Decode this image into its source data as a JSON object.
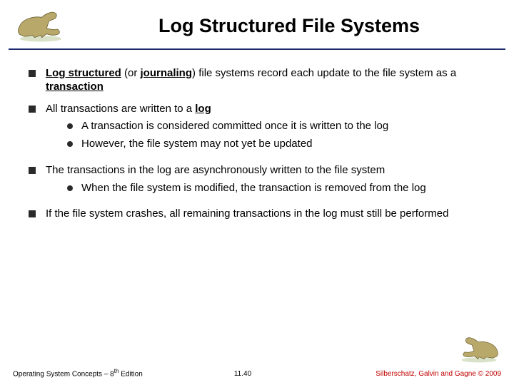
{
  "title": "Log Structured File Systems",
  "bullets": {
    "b1_pre": "Log structured",
    "b1_mid_paren_open": " (or ",
    "b1_journaling": "journaling",
    "b1_mid_paren_close": ") ",
    "b1_post": "file systems record each update to the file system as a ",
    "b1_transaction": "transaction",
    "b2": "All transactions are written to a ",
    "b2_log": "log",
    "b2s1": "A transaction is considered committed once it is written to the log",
    "b2s2": "However, the file system may not yet be updated",
    "b3": "The transactions in the log are asynchronously written to the file system",
    "b3s1": "When the file system is modified, the transaction is removed from the log",
    "b4": "If the file system crashes, all remaining transactions in the log must still be performed"
  },
  "footer": {
    "left_pre": "Operating System Concepts – 8",
    "left_sup": "th",
    "left_post": " Edition",
    "mid": "11.40",
    "right": "Silberschatz, Galvin and Gagne © 2009"
  }
}
